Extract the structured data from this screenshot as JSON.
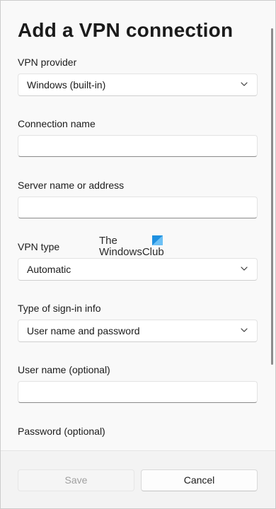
{
  "dialog": {
    "title": "Add a VPN connection"
  },
  "fields": {
    "vpn_provider": {
      "label": "VPN provider",
      "value": "Windows (built-in)"
    },
    "connection_name": {
      "label": "Connection name",
      "value": ""
    },
    "server": {
      "label": "Server name or address",
      "value": ""
    },
    "vpn_type": {
      "label": "VPN type",
      "value": "Automatic"
    },
    "signin_type": {
      "label": "Type of sign-in info",
      "value": "User name and password"
    },
    "username": {
      "label": "User name (optional)",
      "value": ""
    },
    "password": {
      "label": "Password (optional)"
    }
  },
  "watermark": {
    "line1": "The",
    "line2": "WindowsClub",
    "logo_color": "#1e90e0"
  },
  "footer": {
    "save_label": "Save",
    "cancel_label": "Cancel"
  },
  "icons": {
    "dropdown": "chevron-down-icon"
  }
}
